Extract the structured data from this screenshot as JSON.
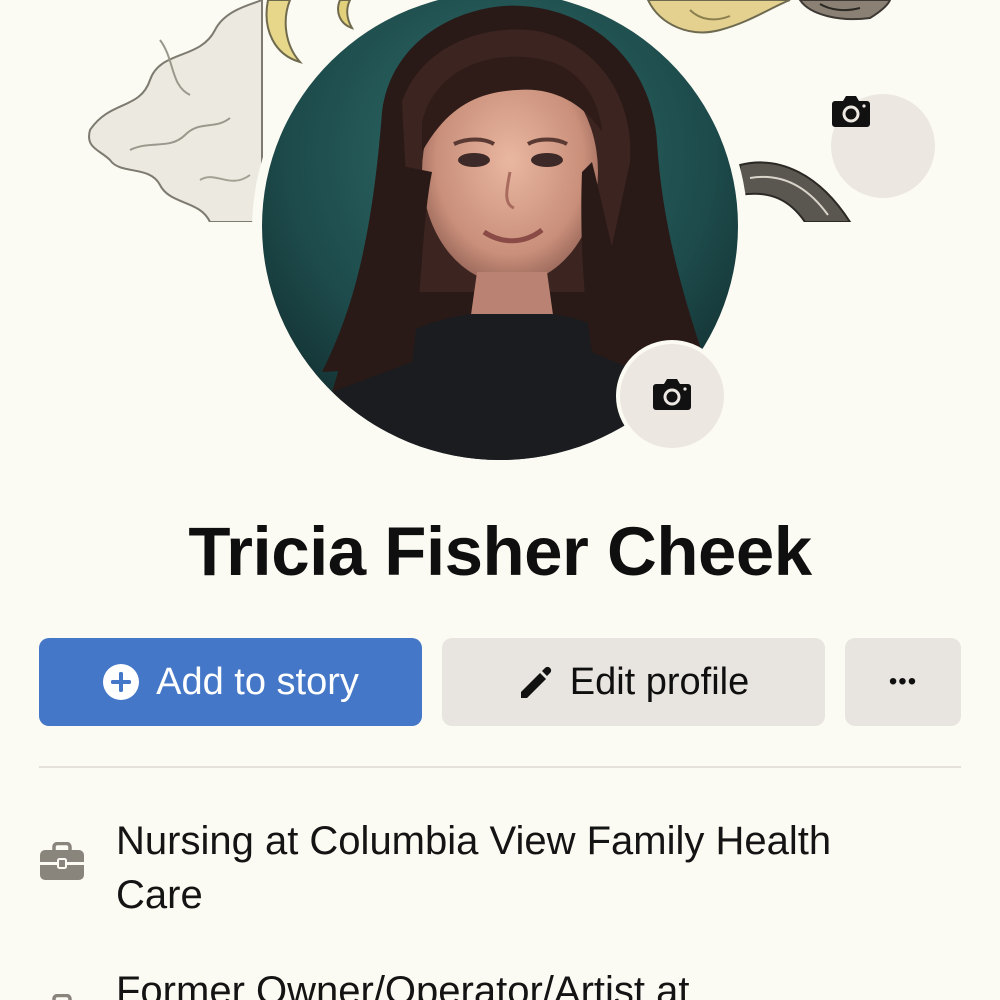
{
  "profile": {
    "name": "Tricia Fisher Cheek"
  },
  "actions": {
    "add_story_label": "Add to story",
    "edit_profile_label": "Edit profile",
    "more_label": "•••"
  },
  "intro": {
    "items": [
      {
        "icon": "briefcase-icon",
        "text": "Nursing at Columbia View Family Health Care"
      },
      {
        "icon": "briefcase-icon",
        "text": "Former Owner/Operator/Artist at"
      }
    ]
  },
  "colors": {
    "page_background": "#fcfbf3",
    "primary_button": "#4577c8",
    "secondary_button": "#e8e4df",
    "camera_button": "#ece7e1",
    "icon_gray": "#8a857c"
  },
  "icons": {
    "cover_camera": "camera-icon",
    "avatar_camera": "camera-icon",
    "add_story": "plus-circle-icon",
    "edit_profile": "pencil-icon",
    "more": "more-dots-icon"
  }
}
